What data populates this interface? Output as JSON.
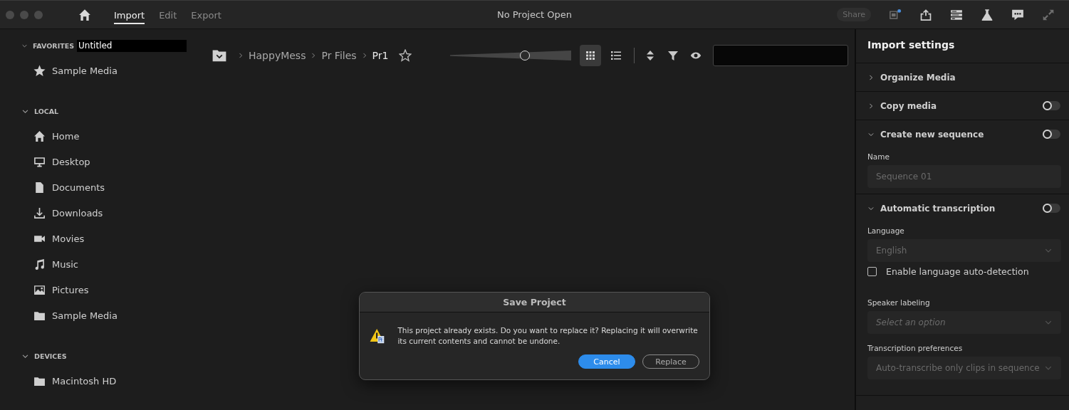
{
  "window": {
    "title": "No Project Open"
  },
  "nav_tabs": [
    {
      "label": "Import",
      "selected": true
    },
    {
      "label": "Edit",
      "selected": false
    },
    {
      "label": "Export",
      "selected": false
    }
  ],
  "share_button": {
    "label": "Share",
    "disabled": true
  },
  "sidebar": {
    "sections": [
      {
        "title": "FAVORITES",
        "expanded": true,
        "rename_field": {
          "value": "Untitled"
        },
        "items": [
          {
            "label": "Sample Media",
            "kind": "star"
          }
        ]
      },
      {
        "title": "LOCAL",
        "expanded": true,
        "items": [
          {
            "label": "Home",
            "kind": "home"
          },
          {
            "label": "Desktop",
            "kind": "monitor"
          },
          {
            "label": "Documents",
            "kind": "document"
          },
          {
            "label": "Downloads",
            "kind": "download"
          },
          {
            "label": "Movies",
            "kind": "camera"
          },
          {
            "label": "Music",
            "kind": "note"
          },
          {
            "label": "Pictures",
            "kind": "image"
          },
          {
            "label": "Sample Media",
            "kind": "folder"
          }
        ]
      },
      {
        "title": "DEVICES",
        "expanded": true,
        "items": [
          {
            "label": "Macintosh HD",
            "kind": "folder"
          }
        ]
      }
    ]
  },
  "browser": {
    "breadcrumbs": [
      {
        "label": "HappyMess",
        "current": false
      },
      {
        "label": "Pr Files",
        "current": false
      },
      {
        "label": "Pr1",
        "current": true
      }
    ],
    "favorite": false,
    "zoom_slider": {
      "level": 0.62
    },
    "view_modes": [
      {
        "kind": "grid",
        "selected": true
      },
      {
        "kind": "list",
        "selected": false
      }
    ]
  },
  "import_settings": {
    "title": "Import settings",
    "sections": [
      {
        "title": "Organize Media",
        "expanded": false
      },
      {
        "title": "Copy media",
        "expanded": false,
        "toggle": {
          "on": false
        }
      },
      {
        "title": "Create new sequence",
        "expanded": true,
        "toggle": {
          "on": false
        },
        "fields": [
          {
            "kind": "text",
            "label": "Name",
            "placeholder": "Sequence 01",
            "disabled": true
          }
        ]
      },
      {
        "title": "Automatic transcription",
        "expanded": true,
        "toggle": {
          "on": false
        },
        "fields": [
          {
            "kind": "select",
            "label": "Language",
            "value": "English",
            "disabled": true
          },
          {
            "kind": "checkbox",
            "label": "Enable language auto-detection",
            "checked": false
          },
          {
            "kind": "select",
            "label": "Speaker labeling",
            "placeholder": "Select an option",
            "disabled": true
          },
          {
            "kind": "select",
            "label": "Transcription preferences",
            "value": "Auto-transcribe only clips in sequence",
            "disabled": true
          }
        ]
      }
    ]
  },
  "dialog": {
    "title": "Save Project",
    "message": "This project already exists. Do you want to replace it? Replacing it will overwrite its current contents and cannot be undone.",
    "buttons": [
      {
        "label": "Cancel",
        "default": true
      },
      {
        "label": "Replace",
        "default": false
      }
    ]
  }
}
